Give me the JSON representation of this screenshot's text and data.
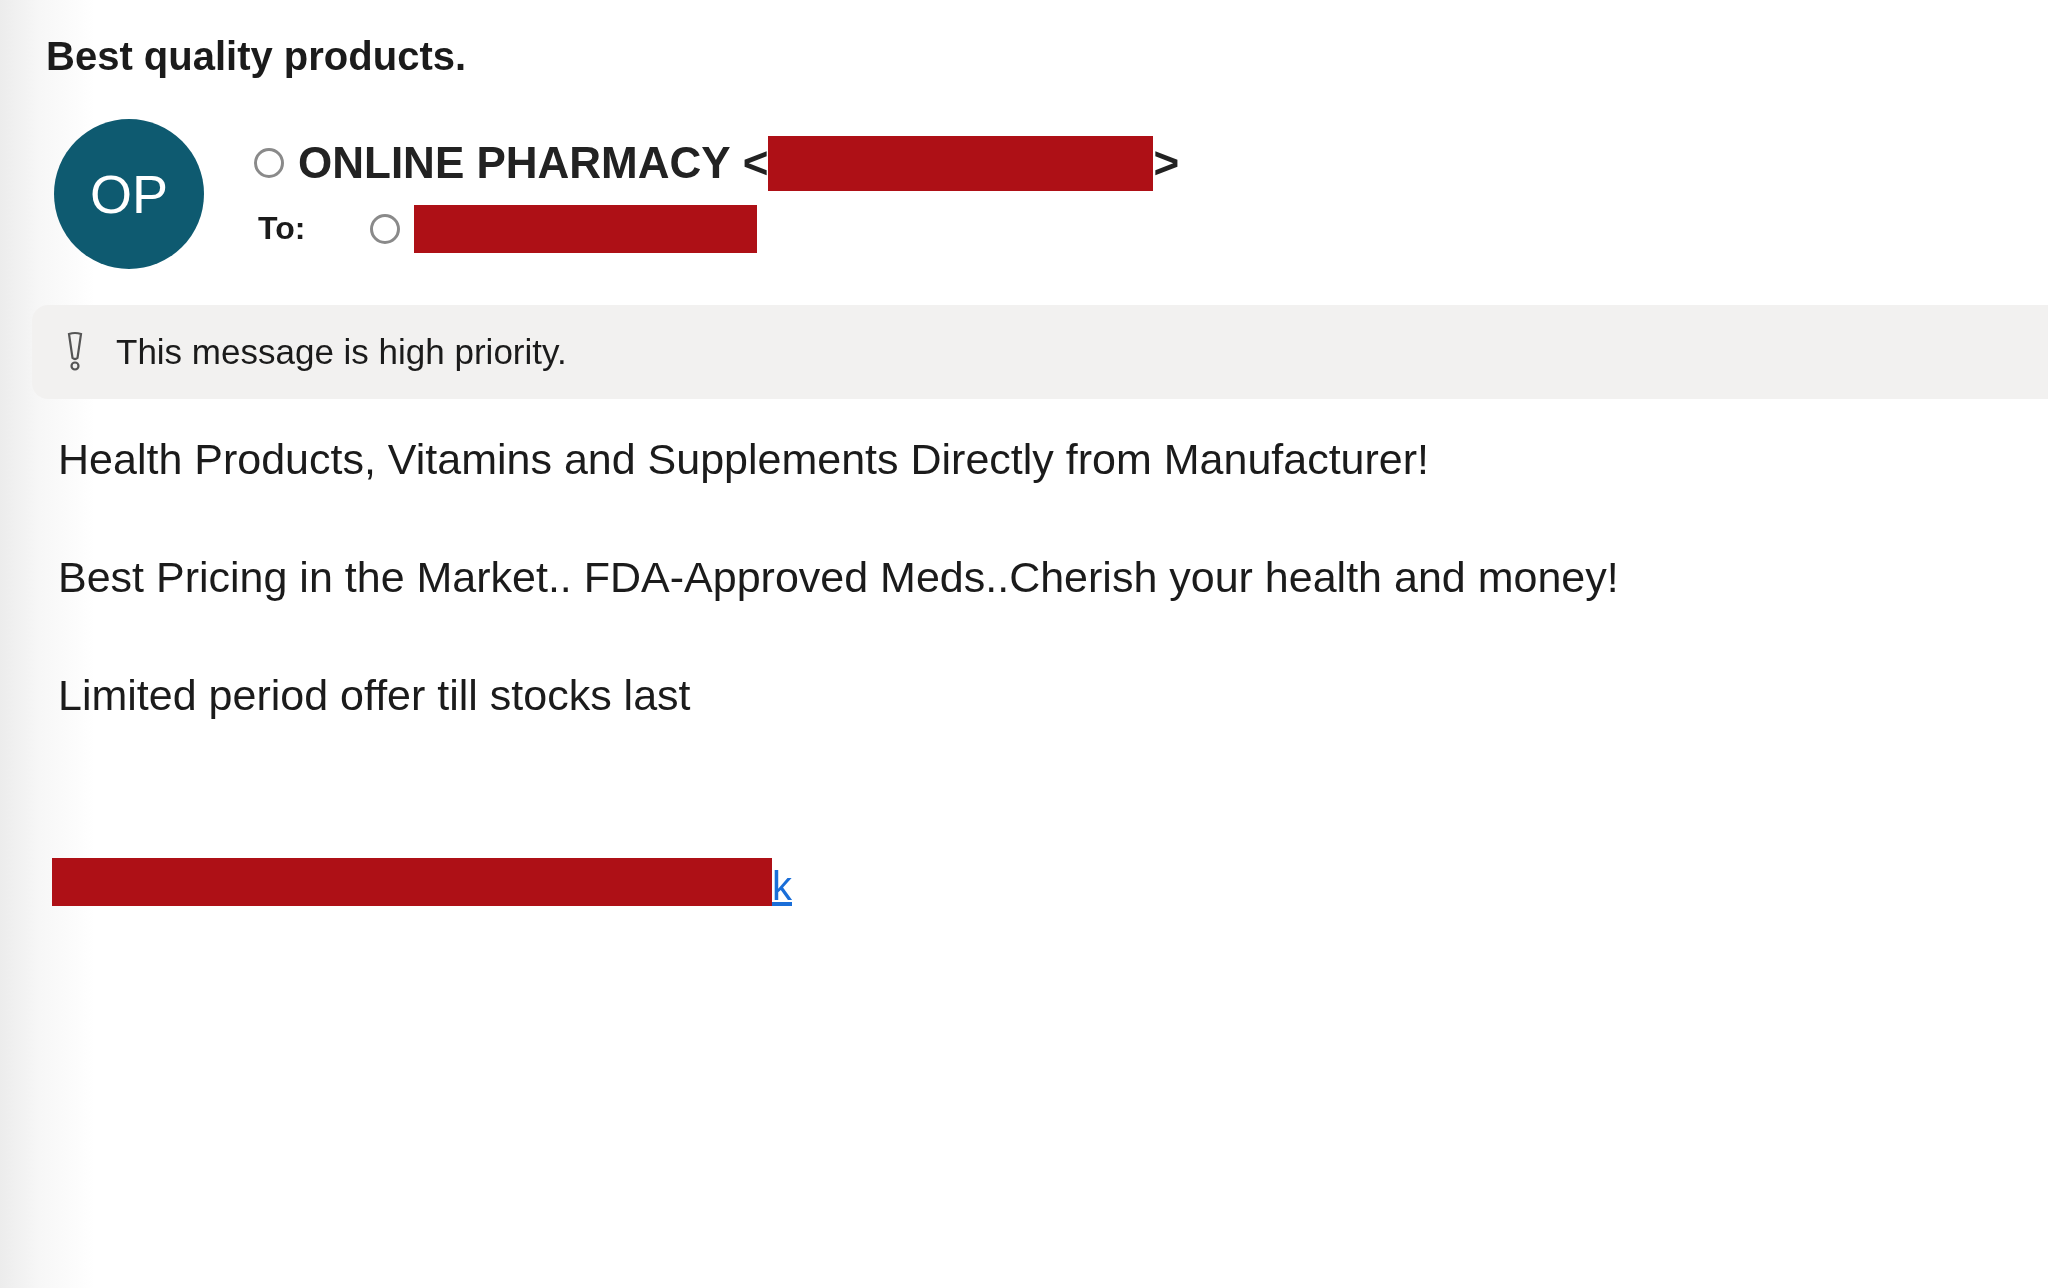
{
  "subject": "Best quality products.",
  "sender": {
    "initials": "OP",
    "name": "ONLINE PHARMACY",
    "open_bracket": "<",
    "close_bracket": ">",
    "address_redacted": true
  },
  "recipient": {
    "label": "To:",
    "address_redacted": true
  },
  "banner": {
    "text": "This message is high priority."
  },
  "body": [
    "Health Products, Vitamins and Supplements Directly from Manufacturer!",
    "Best Pricing in the Market.. FDA-Approved Meds..Cherish your health and money!",
    "Limited period offer till stocks last"
  ],
  "link": {
    "redacted": true,
    "visible_text": "k"
  }
}
